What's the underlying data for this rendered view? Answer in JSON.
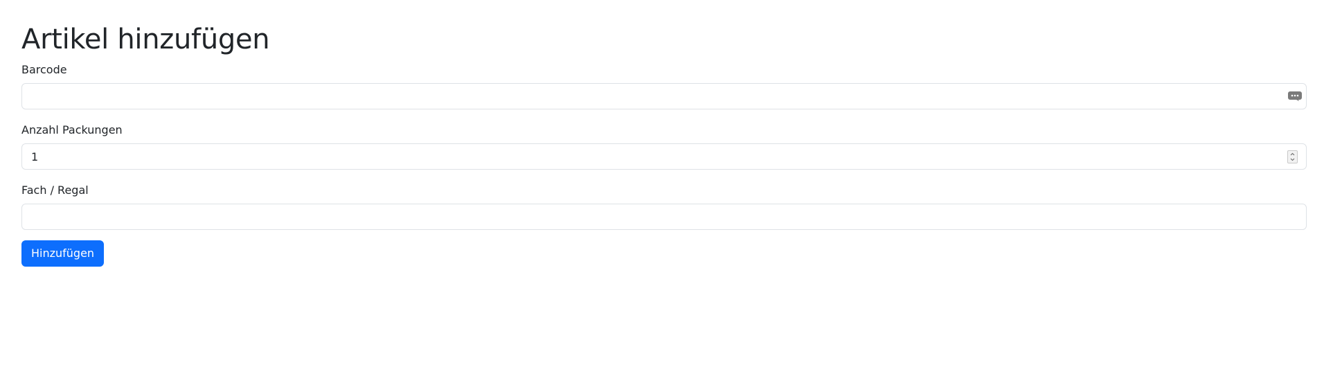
{
  "page": {
    "title": "Artikel hinzufügen"
  },
  "form": {
    "barcode": {
      "label": "Barcode",
      "value": ""
    },
    "packages": {
      "label": "Anzahl Packungen",
      "value": "1"
    },
    "shelf": {
      "label": "Fach / Regal",
      "value": ""
    },
    "submit_label": "Hinzufügen"
  },
  "colors": {
    "primary": "#0d6efd",
    "border": "#dee2e6",
    "text": "#212529"
  },
  "icons": {
    "barcode_field": "chat-bubble-icon",
    "packages_field": "number-spinner-icon"
  }
}
